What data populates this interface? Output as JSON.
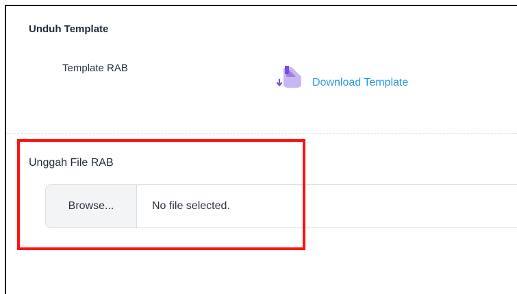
{
  "download_section": {
    "title": "Unduh Template",
    "template_label": "Template RAB",
    "download_link_label": "Download Template",
    "icon": "file-download-icon",
    "icon_color": "#c7b6f2",
    "icon_accent": "#7c4ddb",
    "link_color": "#2b9be0"
  },
  "upload_section": {
    "title": "Unggah File RAB",
    "browse_label": "Browse...",
    "file_status": "No file selected."
  },
  "highlight": {
    "color": "#ff1212"
  }
}
